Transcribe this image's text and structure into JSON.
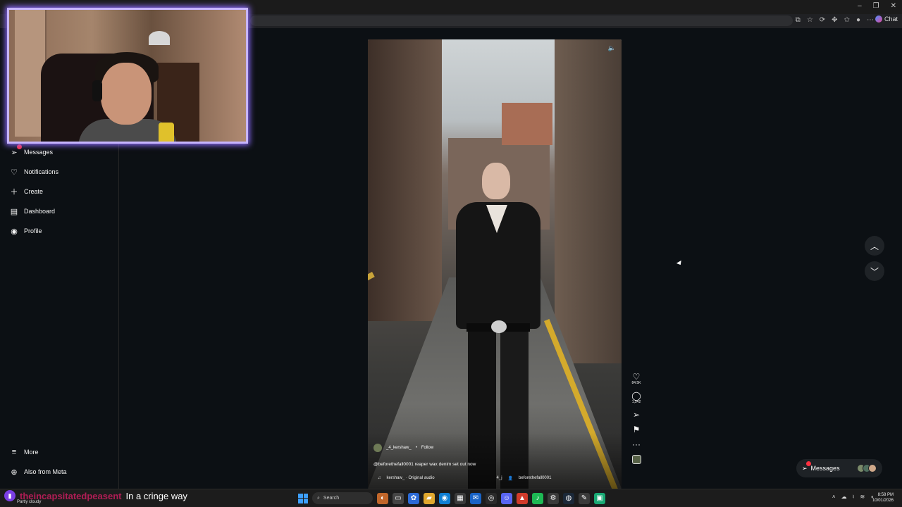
{
  "browser": {
    "chat_label": "Chat",
    "icons": [
      "open-in-app-icon",
      "star-icon",
      "refresh-icon",
      "extensions-icon",
      "favorites-icon",
      "profile-icon"
    ],
    "window_controls": [
      "minimize-icon",
      "restore-icon",
      "close-icon"
    ]
  },
  "sidebar": {
    "items": [
      {
        "label": "Messages",
        "icon": "messenger-icon",
        "badge": true
      },
      {
        "label": "Notifications",
        "icon": "heart-icon"
      },
      {
        "label": "Create",
        "icon": "plus-icon"
      },
      {
        "label": "Dashboard",
        "icon": "chart-icon"
      },
      {
        "label": "Profile",
        "icon": "avatar-icon"
      }
    ],
    "bottom": [
      {
        "label": "More",
        "icon": "menu-icon"
      },
      {
        "label": "Also from Meta",
        "icon": "meta-icon"
      }
    ]
  },
  "reel": {
    "username": "_4_kershaw_",
    "follow_label": "Follow",
    "caption": "@beforethefall0001 reaper wax denim set out now",
    "audio": "kershaw_ · Original audio",
    "tag_count": "4_j",
    "tagged_user": "beforethefall0001",
    "likes": "84.5K",
    "comments": "1,542",
    "more": "···"
  },
  "messages_pill": {
    "label": "Messages",
    "badge": "1"
  },
  "chat_overlay": {
    "username": "theincapsitatedpeasent",
    "message": "In a cringe way"
  },
  "taskbar": {
    "weather": "Partly cloudy",
    "search_label": "Search",
    "time": "8:58 PM",
    "date": "10/01/2026"
  },
  "colors": {
    "app_bg": "#0c1014",
    "webcam_border": "#c7b5ff",
    "badge": "#ff3040",
    "chat_username": "#b01d55"
  }
}
